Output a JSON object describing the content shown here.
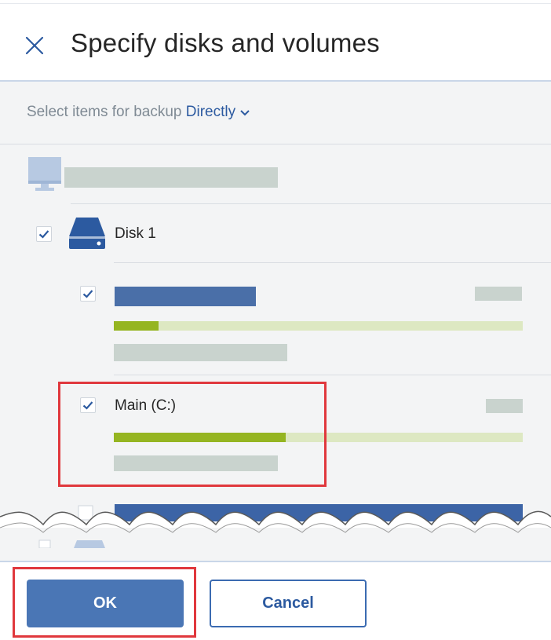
{
  "dialog": {
    "title": "Specify disks and volumes",
    "close_icon": "close-icon"
  },
  "selector": {
    "label": "Select items for backup",
    "mode": "Directly",
    "chevron_icon": "chevron-down-icon"
  },
  "machine": {
    "icon": "monitor-icon"
  },
  "disk": {
    "label": "Disk 1",
    "checked": true,
    "icon": "hard-disk-icon"
  },
  "volumes": [
    {
      "name": "",
      "checked": true,
      "usage_fraction": 0.11
    },
    {
      "name": "Main (C:)",
      "checked": true,
      "usage_fraction": 0.42
    }
  ],
  "footer": {
    "ok_label": "OK",
    "cancel_label": "Cancel"
  },
  "colors": {
    "accent": "#2c5aa0",
    "button_fill": "#4a76b5",
    "usage_bar": "#95b521",
    "usage_track": "#dde8c2",
    "highlight": "#e0383d"
  }
}
